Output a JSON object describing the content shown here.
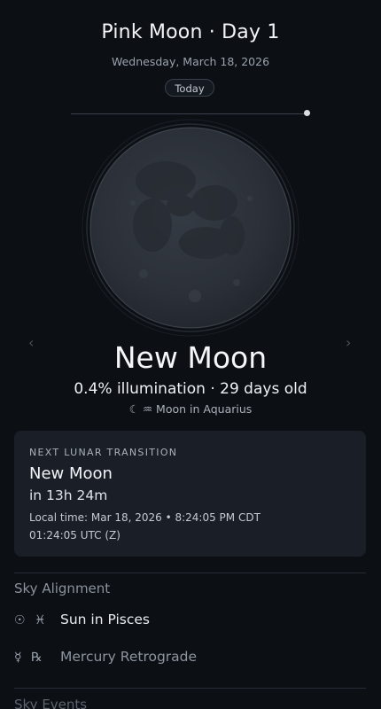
{
  "header": {
    "title": "Pink Moon · Day 1",
    "date": "Wednesday, March 18, 2026",
    "today_label": "Today"
  },
  "timeline": {
    "position": 1.0
  },
  "moon": {
    "nav_prev": "‹",
    "nav_next": "›",
    "phase_name": "New Moon",
    "stats": "0.4% illumination · 29 days old",
    "zodiac": "☾ ♒ Moon in Aquarius",
    "illumination_percent": 0.4
  },
  "next_transition": {
    "kicker": "NEXT LUNAR TRANSITION",
    "phase": "New Moon",
    "countdown": "in 13h 24m",
    "local_time": "Local time: Mar 18, 2026 • 8:24:05 PM CDT",
    "utc_time": "01:24:05 UTC (Z)"
  },
  "sky_alignment": {
    "heading": "Sky Alignment",
    "items": [
      {
        "glyph": "☉ ♓",
        "label": "Sun in Pisces",
        "icon": "sun-pisces-icon",
        "muted": false
      },
      {
        "glyph": "☿ ℞",
        "label": "Mercury Retrograde",
        "icon": "mercury-retrograde-icon",
        "muted": true
      }
    ]
  },
  "sky_events": {
    "heading": "Sky Events"
  },
  "colors": {
    "background": "#0c0f14",
    "card": "#1a1f27",
    "moon_surface": "#2d323a"
  }
}
